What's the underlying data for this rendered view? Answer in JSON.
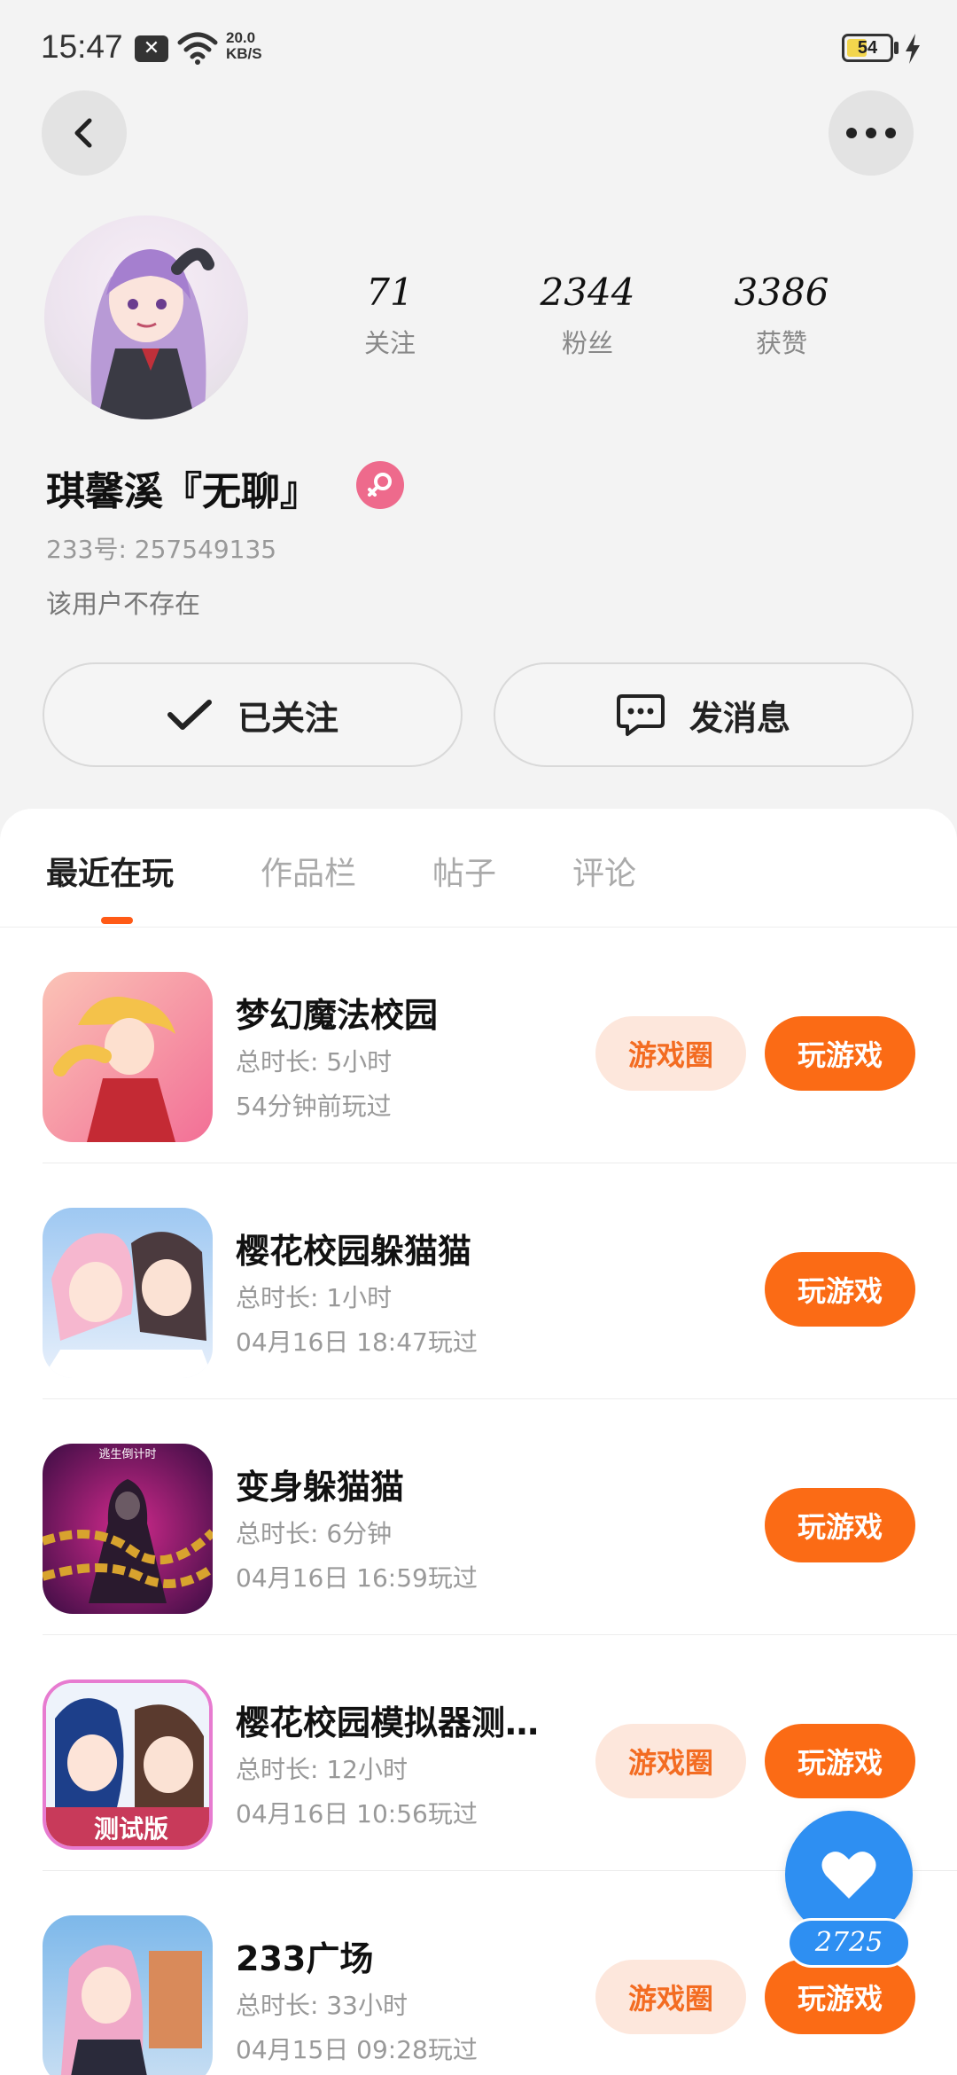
{
  "status_bar": {
    "time": "15:47",
    "speed_value": "20.0",
    "speed_unit": "KB/S",
    "battery": "54"
  },
  "profile": {
    "stats": [
      {
        "value": "71",
        "label": "关注"
      },
      {
        "value": "2344",
        "label": "粉丝"
      },
      {
        "value": "3386",
        "label": "获赞"
      }
    ],
    "name": "琪馨溪『无聊』",
    "uid": "233号: 257549135",
    "bio": "该用户不存在",
    "gender_icon": "female-icon"
  },
  "actions": {
    "follow_label": "已关注",
    "message_label": "发消息"
  },
  "tabs": [
    "最近在玩",
    "作品栏",
    "帖子",
    "评论"
  ],
  "games": [
    {
      "title": "梦幻魔法校园",
      "total": "总时长: 5小时",
      "last": "54分钟前玩过",
      "has_circle": true
    },
    {
      "title": "樱花校园躲猫猫",
      "total": "总时长: 1小时",
      "last": "04月16日 18:47玩过",
      "has_circle": false
    },
    {
      "title": "变身躲猫猫",
      "total": "总时长: 6分钟",
      "last": "04月16日 16:59玩过",
      "has_circle": false
    },
    {
      "title": "樱花校园模拟器测…",
      "total": "总时长: 12小时",
      "last": "04月16日 10:56玩过",
      "has_circle": true
    },
    {
      "title": "233广场",
      "total": "总时长: 33小时",
      "last": "04月15日 09:28玩过",
      "has_circle": true
    }
  ],
  "buttons": {
    "circle_label": "游戏圈",
    "play_label": "玩游戏"
  },
  "icon3_caption": "逃生倒计时",
  "icon4_badge": "测试版",
  "like_count": "2725",
  "colors": {
    "accent": "#fb6b15",
    "accent_soft": "#fde7dc",
    "like_blue": "#2e8ff2",
    "female_pink": "#ee6a8c"
  }
}
